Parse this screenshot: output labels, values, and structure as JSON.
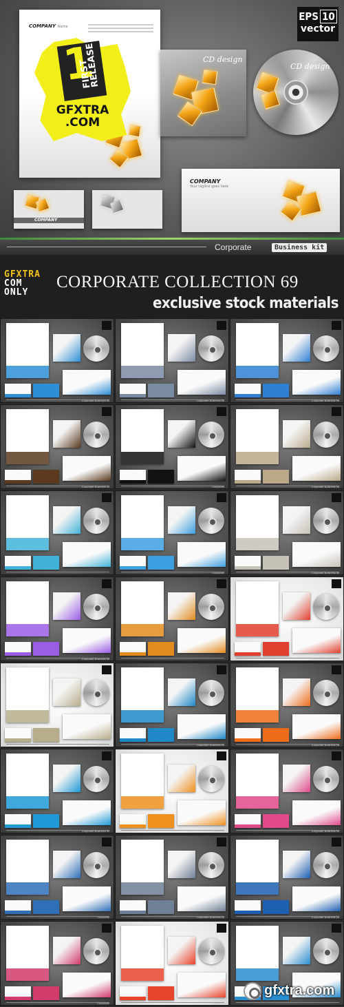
{
  "hero": {
    "company": "COMPANY",
    "company_sub": "Name",
    "badge_number": "1",
    "badge_text": "FIRST RELEASE",
    "site_line1": "GFXTRA",
    "site_line2": ".COM",
    "cd_case_title": "CD design",
    "cd_disc_title": "CD design",
    "eps_label": "EPS",
    "eps_version": "10",
    "eps_word": "vector",
    "envelope_company": "COMPANY",
    "envelope_tagline": "Your tagline goes here",
    "card_label": "COMPANY",
    "footer_corporate": "Corporate",
    "footer_kit": "Business kit",
    "accent_color": "#f2ee1a"
  },
  "header": {
    "brand_line1": "GFXTRA",
    "brand_line2": "COM",
    "brand_line3": "ONLY",
    "title": "CORPORATE COLLECTION 69",
    "subtitle": "exclusive stock materials"
  },
  "tiles": [
    {
      "theme": "dark",
      "accent": "#2e8fd6",
      "footer": "Corporate Business kit"
    },
    {
      "theme": "dark",
      "accent": "#7b8aa3",
      "footer": "Corporate Business kit"
    },
    {
      "theme": "dark",
      "accent": "#2f7fd3",
      "footer": "Corporate Business kit"
    },
    {
      "theme": "dark",
      "accent": "#5a3b1e",
      "footer": "Corporate Business kit"
    },
    {
      "theme": "dark",
      "accent": "#111111",
      "footer": "Corporate"
    },
    {
      "theme": "dark",
      "accent": "#b9a98a",
      "footer": "Corporate Business kit"
    },
    {
      "theme": "dark",
      "accent": "#42b3d8",
      "footer": ""
    },
    {
      "theme": "dark",
      "accent": "#3d9fe0",
      "footer": "Corporate"
    },
    {
      "theme": "dark",
      "accent": "#c7c2b8",
      "footer": "Corporate Business kit"
    },
    {
      "theme": "dark",
      "accent": "#9b5de5",
      "footer": "Corporate Business kit"
    },
    {
      "theme": "dark",
      "accent": "#e38b1f",
      "footer": ""
    },
    {
      "theme": "light",
      "accent": "#e0402f",
      "footer": "Corporate Business Kit"
    },
    {
      "theme": "light",
      "accent": "#b8ad8a",
      "footer": "Corporate"
    },
    {
      "theme": "dark",
      "accent": "#1e88c8",
      "footer": "Corporate Business kit"
    },
    {
      "theme": "dark",
      "accent": "#ef6c1a",
      "footer": "Corporate Business kit"
    },
    {
      "theme": "dark",
      "accent": "#1f9ad6",
      "footer": "Corporate Business kit"
    },
    {
      "theme": "light",
      "accent": "#f0901e",
      "footer": "Corporate"
    },
    {
      "theme": "dark",
      "accent": "#e04a8a",
      "footer": "Corporate Business kit"
    },
    {
      "theme": "dark",
      "accent": "#2f6fb8",
      "footer": "Corporate"
    },
    {
      "theme": "dark",
      "accent": "#6f7f95",
      "footer": "Corporate Business kit"
    },
    {
      "theme": "dark",
      "accent": "#1d5fb0",
      "footer": "Corporate Business kit"
    },
    {
      "theme": "dark",
      "accent": "#d23b6a",
      "footer": "Corporate"
    },
    {
      "theme": "light",
      "accent": "#e8432b",
      "footer": "Corporate"
    },
    {
      "theme": "dark",
      "accent": "#2a8ed0",
      "footer": ""
    }
  ],
  "watermark": {
    "text": "gfxtra.com"
  }
}
